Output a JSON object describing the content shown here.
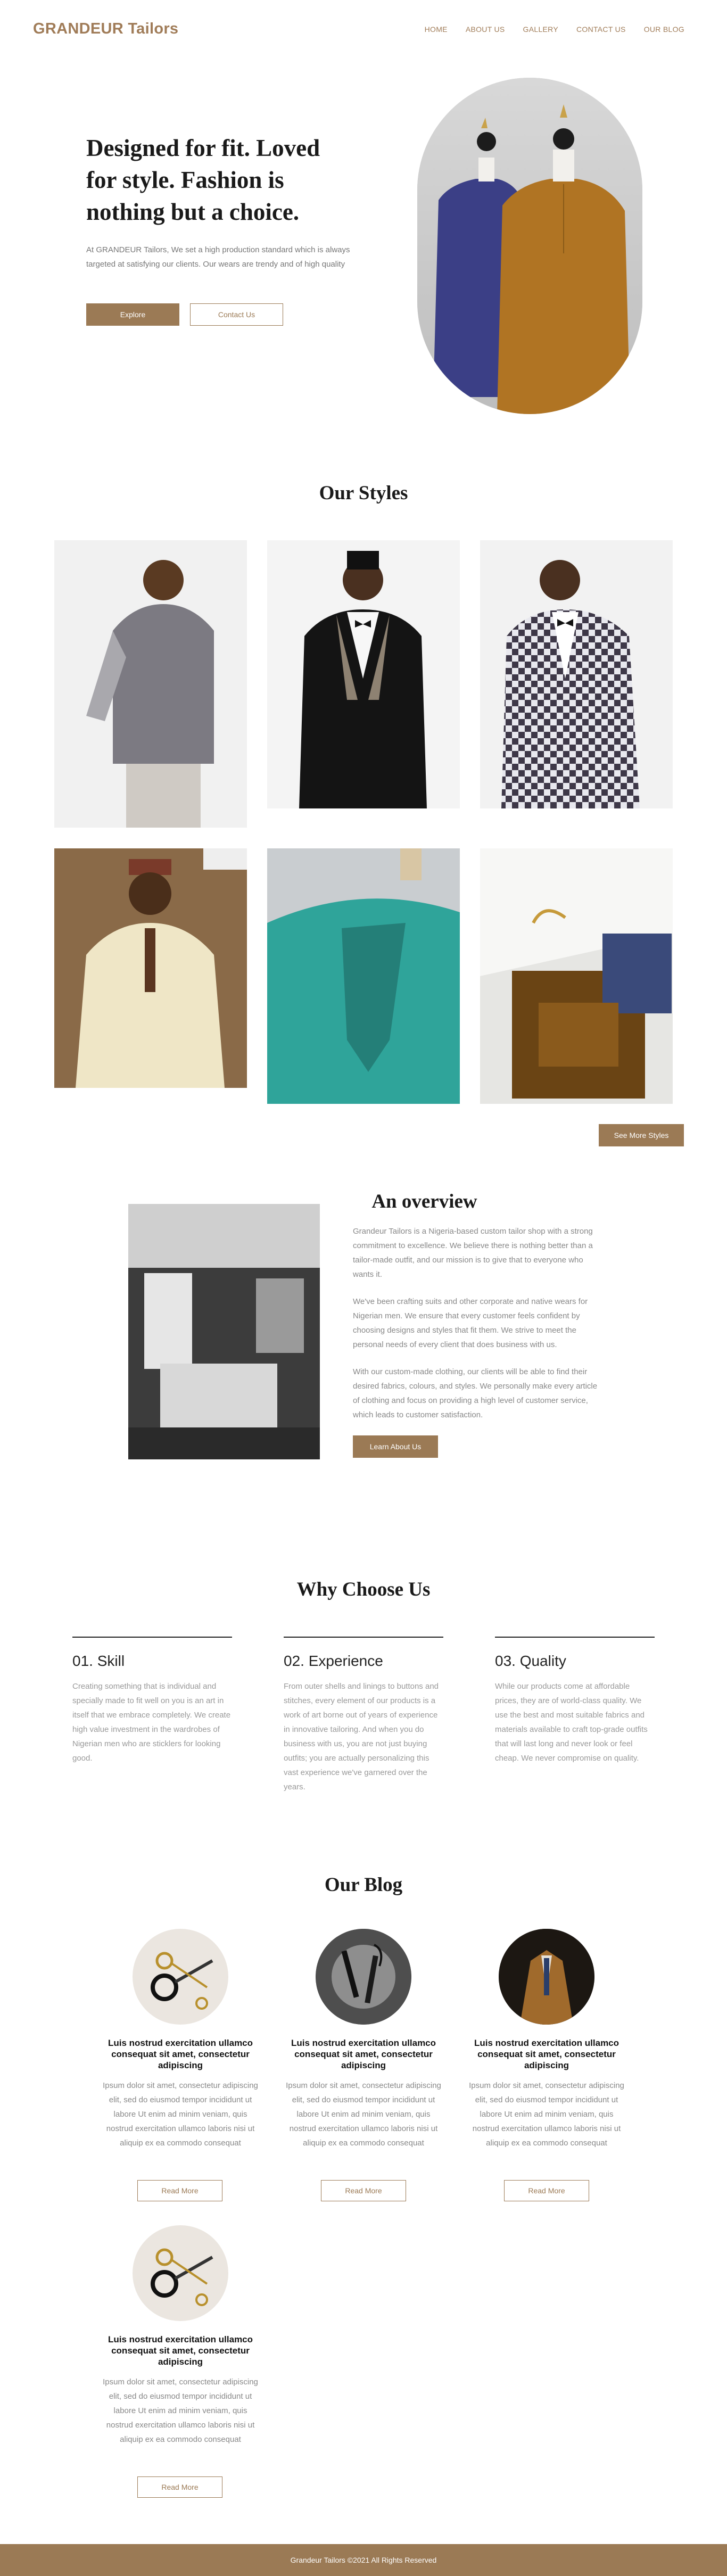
{
  "brand": {
    "logo": "GRANDEUR Tailors",
    "accent": "#9b7a55"
  },
  "nav": [
    {
      "label": "HOME"
    },
    {
      "label": "ABOUT US"
    },
    {
      "label": "GALLERY"
    },
    {
      "label": "CONTACT US"
    },
    {
      "label": "OUR BLOG"
    }
  ],
  "hero": {
    "title": "Designed for fit. Loved for style. Fashion is nothing but a choice.",
    "text": "At GRANDEUR Tailors, We set a high production standard which is always targeted at satisfying our clients. Our wears are trendy and of high quality",
    "explore": "Explore",
    "contact": "Contact Us"
  },
  "styles": {
    "title": "Our Styles",
    "see_more": "See More Styles"
  },
  "overview": {
    "title": "An overview",
    "p1": "Grandeur Tailors is a Nigeria-based custom tailor shop with a strong commitment to excellence. We believe there is nothing better than a tailor-made outfit, and our mission is to give that to everyone who wants it.",
    "p2": "We've been crafting suits and other corporate and native wears for Nigerian men. We ensure that every customer feels confident by choosing designs and styles that fit them. We strive to meet the personal needs of every client that does business with us.",
    "p3": "With our custom-made clothing, our clients will be able to find their desired fabrics, colours, and styles. We personally make every article of clothing and focus on providing a high level of customer service, which leads to customer satisfaction.",
    "button": "Learn About Us"
  },
  "why": {
    "title": "Why Choose Us",
    "items": [
      {
        "heading": "01. Skill",
        "text": "Creating something that is individual and specially made to fit well on you is an art in itself that we embrace completely. We create high value investment in the wardrobes of Nigerian men who are sticklers for looking good."
      },
      {
        "heading": "02. Experience",
        "text": "From outer shells and linings to buttons and stitches, every element of our products is a work of art borne out of years of experience in innovative tailoring. And when you do business with us, you are not just buying outfits; you are actually personalizing this vast experience we've garnered over the years."
      },
      {
        "heading": "03. Quality",
        "text": "While our products come at affordable prices, they are of world-class quality. We use the best and most suitable fabrics and materials available to craft top-grade outfits that will last long and never look or feel cheap. We never compromise on quality."
      }
    ]
  },
  "blog": {
    "title": "Our Blog",
    "posts": [
      {
        "title": "Luis nostrud exercitation ullamco consequat sit amet, consectetur adipiscing",
        "text": "Ipsum dolor sit amet, consectetur adipiscing elit, sed do eiusmod tempor incididunt ut labore Ut enim ad minim veniam, quis nostrud exercitation ullamco laboris nisi ut aliquip ex ea commodo consequat",
        "button": "Read More"
      },
      {
        "title": "Luis nostrud exercitation ullamco consequat sit amet, consectetur adipiscing",
        "text": "Ipsum dolor sit amet, consectetur adipiscing elit, sed do eiusmod tempor incididunt ut labore Ut enim ad minim veniam, quis nostrud exercitation ullamco laboris nisi ut aliquip ex ea commodo consequat",
        "button": "Read More"
      },
      {
        "title": "Luis nostrud exercitation ullamco consequat sit amet, consectetur adipiscing",
        "text": "Ipsum dolor sit amet, consectetur adipiscing elit, sed do eiusmod tempor incididunt ut labore Ut enim ad minim veniam, quis nostrud exercitation ullamco laboris nisi ut aliquip ex ea commodo consequat",
        "button": "Read More"
      },
      {
        "title": "Luis nostrud exercitation ullamco consequat sit amet, consectetur adipiscing",
        "text": "Ipsum dolor sit amet, consectetur adipiscing elit, sed do eiusmod tempor incididunt ut labore Ut enim ad minim veniam, quis nostrud exercitation ullamco laboris nisi ut aliquip ex ea commodo consequat",
        "button": "Read More"
      }
    ]
  },
  "footer": {
    "text": "Grandeur Tailors ©2021 All Rights Reserved"
  }
}
